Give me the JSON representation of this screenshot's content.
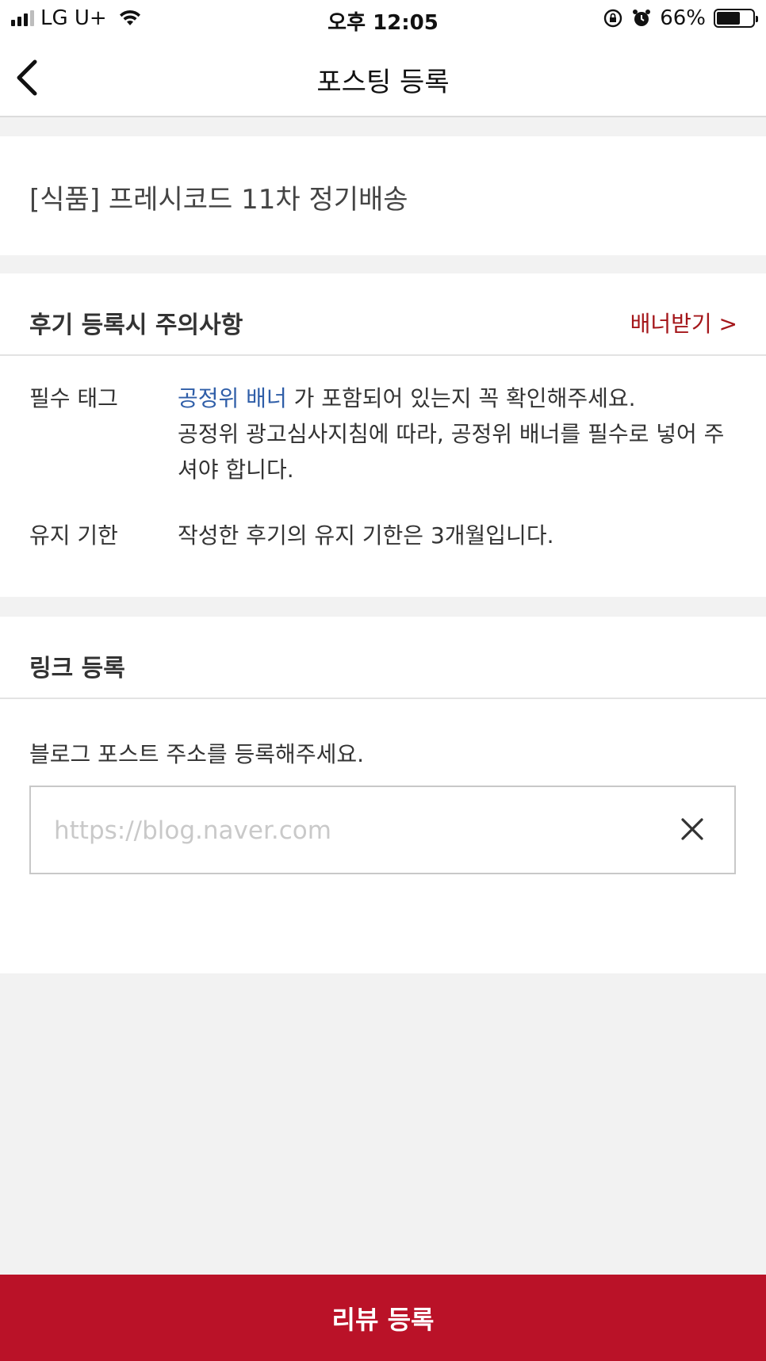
{
  "status_bar": {
    "carrier": "LG U+",
    "time": "오후 12:05",
    "battery": "66%",
    "battery_level": 0.66
  },
  "nav": {
    "title": "포스팅 등록"
  },
  "product": {
    "title": "[식품] 프레시코드 11차 정기배송"
  },
  "notice": {
    "title": "후기 등록시 주의사항",
    "banner_link": "배너받기 >",
    "tag_label": "필수 태그",
    "tag_highlight": "공정위 배너",
    "tag_text_1": " 가 포함되어 있는지 꼭 확인해주세요.",
    "tag_text_2": "공정위 광고심사지침에 따라, 공정위 배너를 필수로 넣어 주셔야 합니다.",
    "keep_label": "유지 기한",
    "keep_text": "작성한 후기의 유지 기한은 3개월입니다."
  },
  "link": {
    "title": "링크 등록",
    "instruction": "블로그 포스트 주소를 등록해주세요.",
    "url_value": "",
    "url_placeholder": "https://blog.naver.com"
  },
  "submit": {
    "label": "리뷰 등록"
  },
  "colors": {
    "accent": "#ba1228",
    "link_red": "#a4161a",
    "link_blue": "#2f5ea8"
  }
}
